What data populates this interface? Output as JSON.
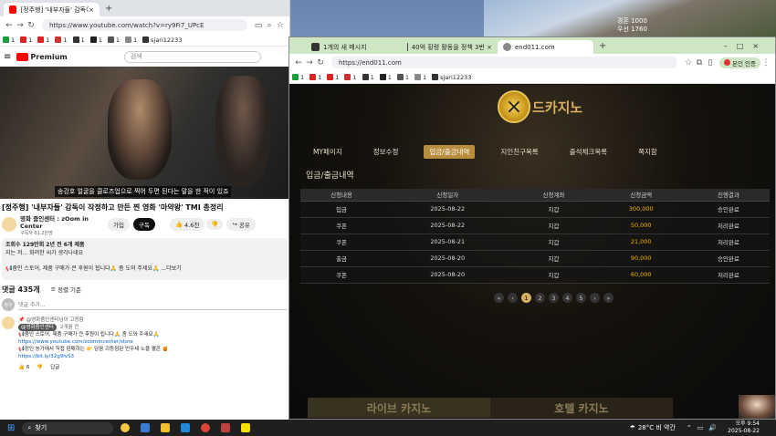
{
  "desktop": {
    "stock_lines": [
      "경혼 1000",
      "우선 1760"
    ]
  },
  "left_window": {
    "tab_title": "[정주행] '내부자들' 감독이 작",
    "url": "https://www.youtube.com/watch?v=ry9Fi7_UPcE",
    "bookmarks": [
      "1",
      "1",
      "1",
      "1",
      "1",
      "1",
      "1",
      "1",
      "sjari12233"
    ],
    "yt_logo": "Premium",
    "search_placeholder": "검색",
    "video_caption": "송강호 얼굴을 클로즈업으로 찍어 두면 된다는 말을 한 적이 있죠",
    "video_title": "[정주행] '내부자들' 감독이 작정하고 만든 찐 영화 '마약왕' TMI 총정리",
    "channel_name": "영화 줌인센터 : zOom in Center",
    "channel_subs": "구독자 61.2만명",
    "join_label": "가입",
    "subscribe_label": "구독",
    "like_count": "4.6천",
    "share_label": "공유",
    "desc_views": "조회수 129만회  2년 전  6개 제품",
    "desc_line": "지는 저... 화려한 씨가 생각나네요",
    "promo_line": "📢줌인 스토어, 제품 구매가 큰 후원이 됩니다🙏 좀 도와 주세요🙏 ...더보기",
    "comments_title": "댓글 435개",
    "sort_label": "정렬 기준",
    "avatar_label": "정우",
    "comment_placeholder": "댓글 추가...",
    "pinned": "📌 @영화줌인센터님이 고정함",
    "comment_author": "@영화줌인센터",
    "comment_time": "2개월 전",
    "comment_lines": [
      "📢줌인 스토어, 제품 구매가 큰 후원이 됩니다🙏 좀 도와 주세요🙏",
      "https://www.youtube.com/zoomincenter/store",
      "📢정인 농가에서 직접 판매하는 👉 담음 괴등점된 먼우세 노을 펼콘 🍯",
      "https://bit.ly/32g9lvS3"
    ],
    "comment_likes": "6",
    "reply_label": "답글"
  },
  "right_window": {
    "tabs": [
      "1개의 새 메시지",
      "40억 횡령 활동을 정책 3번 ×",
      "end011.com"
    ],
    "url": "https://end011.com",
    "profile_label": "본인 인증",
    "bookmarks": [
      "1",
      "1",
      "1",
      "1",
      "1",
      "1",
      "1",
      "1",
      "sjari12233"
    ],
    "site_logo": "드카지노",
    "menu": [
      "MY페이지",
      "정보수정",
      "입금/출금내역",
      "지인친구목록",
      "출석체크목록",
      "쪽지함"
    ],
    "active_menu_index": 2,
    "section_title": "입금/출금내역",
    "table_headers": [
      "신청내용",
      "신청일자",
      "신청계좌",
      "신청금액",
      "진행결과"
    ],
    "rows": [
      [
        "입금",
        "2025-08-22",
        "지갑",
        "300,000",
        "승인완료"
      ],
      [
        "쿠폰",
        "2025-08-22",
        "지갑",
        "50,000",
        "처리완료"
      ],
      [
        "쿠폰",
        "2025-08-21",
        "지갑",
        "21,000",
        "처리완료"
      ],
      [
        "출금",
        "2025-08-20",
        "지갑",
        "90,000",
        "승인완료"
      ],
      [
        "쿠폰",
        "2025-08-20",
        "지갑",
        "60,000",
        "처리완료"
      ]
    ],
    "pagination": [
      "«",
      "‹",
      "1",
      "2",
      "3",
      "4",
      "5",
      "›",
      "»"
    ],
    "current_page": "1",
    "banners": [
      "라이브 카지노",
      "호텔 카지노"
    ]
  },
  "taskbar": {
    "search_placeholder": "찾기",
    "weather": "28°C 비 약간",
    "time": "오후 9:54",
    "date": "2025-08-22"
  },
  "colors": {
    "yt_red": "#ff0000",
    "gold": "#f0b400",
    "menu_active": "#b78e3e"
  }
}
